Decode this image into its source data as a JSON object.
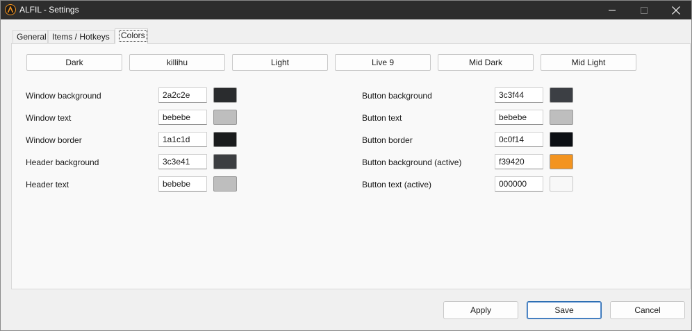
{
  "window": {
    "title": "ALFIL - Settings",
    "accent": "#f39420"
  },
  "tabs": [
    {
      "label": "General"
    },
    {
      "label": "Items / Hotkeys"
    },
    {
      "label": "Colors",
      "selected": true
    }
  ],
  "presets": [
    {
      "label": "Dark"
    },
    {
      "label": "killihu"
    },
    {
      "label": "Light"
    },
    {
      "label": "Live 9"
    },
    {
      "label": "Mid Dark"
    },
    {
      "label": "Mid Light"
    }
  ],
  "left_colors": [
    {
      "label": "Window background",
      "value": "2a2c2e",
      "swatch": "#2a2c2e"
    },
    {
      "label": "Window text",
      "value": "bebebe",
      "swatch": "#bebebe"
    },
    {
      "label": "Window border",
      "value": "1a1c1d",
      "swatch": "#1a1c1d"
    },
    {
      "label": "Header background",
      "value": "3c3e41",
      "swatch": "#3c3e41"
    },
    {
      "label": "Header text",
      "value": "bebebe",
      "swatch": "#bebebe"
    }
  ],
  "right_colors": [
    {
      "label": "Button background",
      "value": "3c3f44",
      "swatch": "#3c3f44"
    },
    {
      "label": "Button text",
      "value": "bebebe",
      "swatch": "#bebebe"
    },
    {
      "label": "Button border",
      "value": "0c0f14",
      "swatch": "#0c0f14"
    },
    {
      "label": "Button background (active)",
      "value": "f39420",
      "swatch": "#f39420"
    },
    {
      "label": "Button text (active)",
      "value": "000000",
      "swatch": "#f8f8f8"
    }
  ],
  "footer": {
    "apply_label": "Apply",
    "save_label": "Save",
    "cancel_label": "Cancel"
  }
}
